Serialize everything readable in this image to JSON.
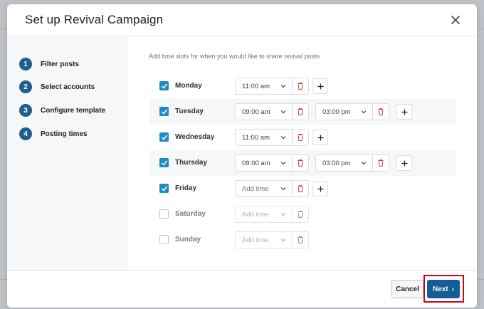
{
  "modal": {
    "title": "Set up Revival Campaign",
    "close_icon": "close-icon"
  },
  "steps": [
    {
      "number": "1",
      "label": "Filter posts"
    },
    {
      "number": "2",
      "label": "Select accounts"
    },
    {
      "number": "3",
      "label": "Configure template"
    },
    {
      "number": "4",
      "label": "Posting times"
    }
  ],
  "content": {
    "intro": "Add time slots for when you would like to share revival posts"
  },
  "days": [
    {
      "name": "Monday",
      "checked": true,
      "slots": [
        "11:00 am"
      ]
    },
    {
      "name": "Tuesday",
      "checked": true,
      "slots": [
        "09:00 am",
        "03:00 pm"
      ]
    },
    {
      "name": "Wednesday",
      "checked": true,
      "slots": [
        "11:00 am"
      ]
    },
    {
      "name": "Thursday",
      "checked": true,
      "slots": [
        "09:00 am",
        "03:00 pm"
      ]
    },
    {
      "name": "Friday",
      "checked": true,
      "slots": [
        "Add time"
      ]
    },
    {
      "name": "Saturday",
      "checked": false,
      "slots": [
        "Add time"
      ]
    },
    {
      "name": "Sunday",
      "checked": false,
      "slots": [
        "Add time"
      ]
    }
  ],
  "footer": {
    "cancel_label": "Cancel",
    "next_label": "Next",
    "next_arrow": "›"
  },
  "colors": {
    "accent": "#135e96",
    "checkbox": "#1e8bc9",
    "delete": "#d63638",
    "highlight": "#d0021b"
  }
}
